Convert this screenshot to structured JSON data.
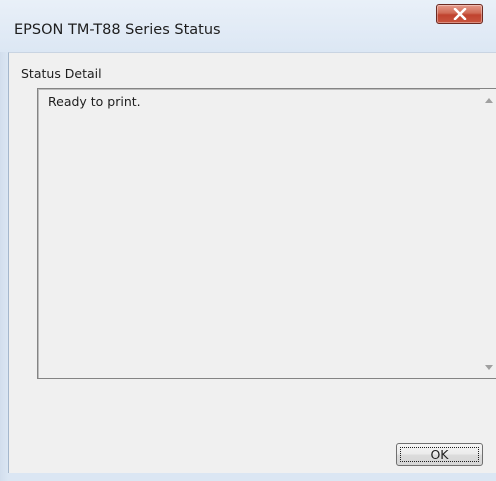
{
  "window": {
    "title": "EPSON TM-T88 Series Status",
    "close_icon": "close-icon"
  },
  "group": {
    "label": "Status Detail"
  },
  "status": {
    "text": "Ready to print.",
    "scroll_up_icon": "scroll-up-arrow-icon",
    "scroll_down_icon": "scroll-down-arrow-icon"
  },
  "buttons": {
    "ok_label": "OK"
  },
  "colors": {
    "frame": "#dbe6f3",
    "client": "#f0f0f0",
    "close_button": "#c9553e"
  }
}
